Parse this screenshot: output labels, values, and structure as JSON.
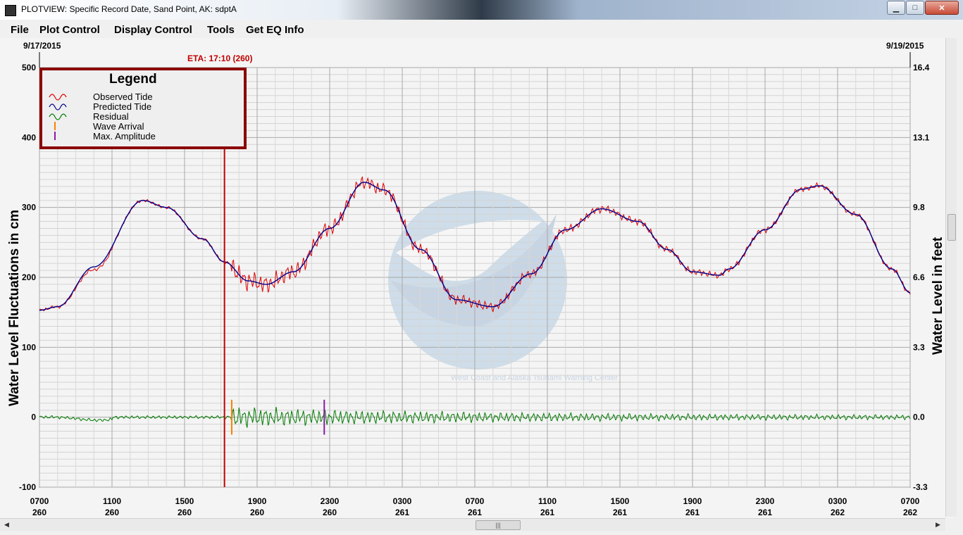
{
  "window": {
    "title": "PLOTVIEW: Specific Record Date, Sand Point, AK: sdptA"
  },
  "menu": {
    "items": [
      "File",
      "Plot Control",
      "Display Control",
      "Tools",
      "Get EQ Info"
    ]
  },
  "plot": {
    "date_left": "9/17/2015",
    "date_right": "9/19/2015",
    "eta_label": "ETA: 17:10 (260)",
    "left_axis_label": "Water Level Fluctuations in cm",
    "right_axis_label": "Water Level in feet",
    "watermark": "West Coast and Alaska Tsunami Warning Center",
    "legend": {
      "title": "Legend",
      "items": [
        "Observed Tide",
        "Predicted Tide",
        "Residual",
        "Wave Arrival",
        "Max. Amplitude"
      ]
    }
  },
  "chart_data": {
    "type": "line",
    "x_unit": "hours since 0700 day 260",
    "xlim": [
      0,
      48
    ],
    "ylim": [
      -100,
      500
    ],
    "y_ticks": [
      "500",
      "400",
      "300",
      "200",
      "100",
      "0",
      "-100"
    ],
    "y2_ticks": [
      "16.4",
      "13.1",
      "9.8",
      "6.6",
      "3.3",
      "0.0",
      "-3.3"
    ],
    "x_ticks": [
      {
        "time": "0700",
        "day": "260"
      },
      {
        "time": "1100",
        "day": "260"
      },
      {
        "time": "1500",
        "day": "260"
      },
      {
        "time": "1900",
        "day": "260"
      },
      {
        "time": "2300",
        "day": "260"
      },
      {
        "time": "0300",
        "day": "261"
      },
      {
        "time": "0700",
        "day": "261"
      },
      {
        "time": "1100",
        "day": "261"
      },
      {
        "time": "1500",
        "day": "261"
      },
      {
        "time": "1900",
        "day": "261"
      },
      {
        "time": "2300",
        "day": "261"
      },
      {
        "time": "0300",
        "day": "262"
      },
      {
        "time": "0700",
        "day": "262"
      }
    ],
    "predicted_tide": {
      "name": "Predicted Tide",
      "x": [
        0,
        1,
        3,
        5.7,
        7,
        9,
        10.2,
        11.5,
        12.5,
        14,
        16,
        17.9,
        19,
        21,
        23,
        25,
        27.1,
        29,
        31,
        33,
        34.6,
        36,
        37.5,
        38,
        40,
        42,
        43,
        45,
        47,
        48
      ],
      "y": [
        153,
        158,
        215,
        310,
        300,
        255,
        222,
        195,
        190,
        208,
        270,
        336,
        325,
        240,
        168,
        158,
        205,
        268,
        298,
        280,
        240,
        208,
        203,
        212,
        268,
        326,
        331,
        290,
        212,
        178
      ]
    },
    "observed_tide": {
      "name": "Observed Tide",
      "note": "follows predicted tide with oscillations"
    },
    "residual": {
      "name": "Residual",
      "baseline": 0,
      "max_amplitude_cm": 20
    },
    "wave_arrival_x": 10.6,
    "max_amplitude_x": 15.7,
    "eta_x": 10.2,
    "colors": {
      "observed": "#e00000",
      "predicted": "#00008b",
      "residual": "#007a00",
      "wave_arrival": "#ff8000",
      "max_amplitude": "#8a1aa8",
      "eta_line": "#c00000",
      "legend_border": "#8b0000"
    }
  }
}
